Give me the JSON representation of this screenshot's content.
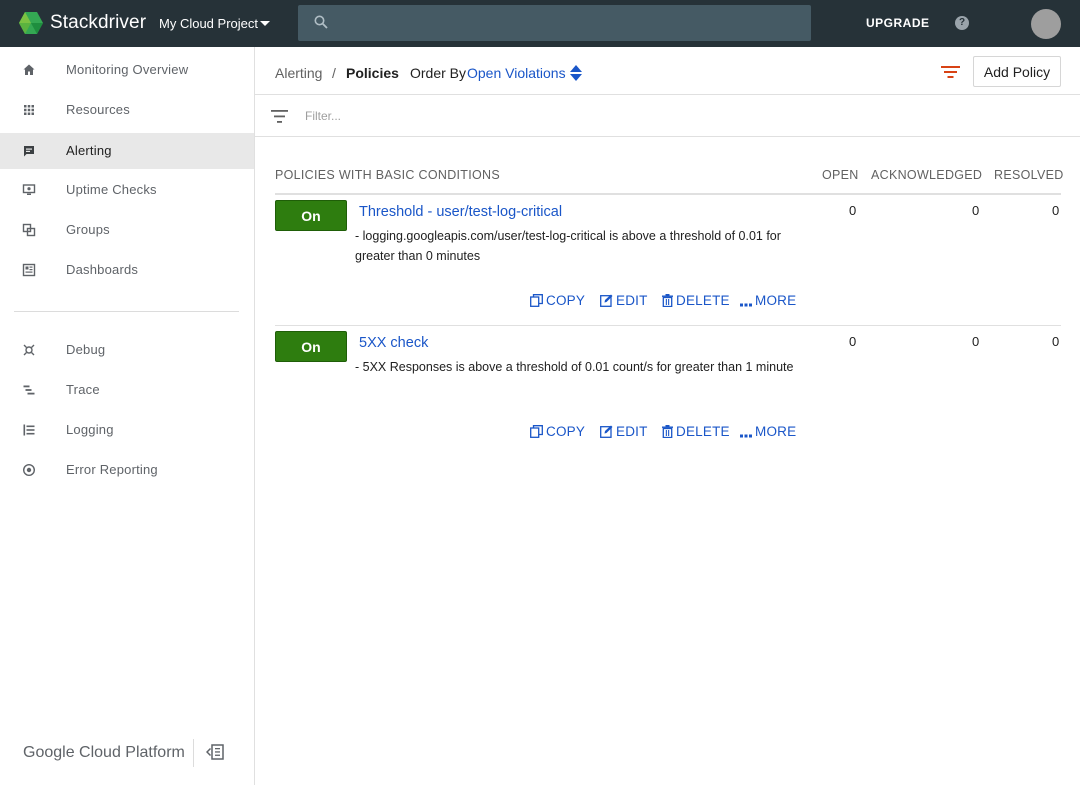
{
  "topbar": {
    "brand": "Stackdriver",
    "project": "My Cloud Project",
    "search_placeholder": "",
    "upgrade": "UPGRADE",
    "help": "?"
  },
  "sidebar": {
    "items": [
      {
        "label": "Monitoring Overview",
        "icon": "home-icon"
      },
      {
        "label": "Resources",
        "icon": "grid-icon"
      },
      {
        "label": "Alerting",
        "icon": "alert-comment-icon",
        "active": true
      },
      {
        "label": "Uptime Checks",
        "icon": "monitor-icon"
      },
      {
        "label": "Groups",
        "icon": "groups-icon"
      },
      {
        "label": "Dashboards",
        "icon": "dashboard-icon"
      }
    ],
    "items2": [
      {
        "label": "Debug",
        "icon": "debug-icon"
      },
      {
        "label": "Trace",
        "icon": "trace-icon"
      },
      {
        "label": "Logging",
        "icon": "logging-icon"
      },
      {
        "label": "Error Reporting",
        "icon": "error-reporting-icon"
      }
    ],
    "footer": "Google Cloud Platform"
  },
  "header": {
    "breadcrumb_parent": "Alerting",
    "breadcrumb_sep": "/",
    "breadcrumb_current": "Policies",
    "order_by_label": "Order By",
    "order_by_value": "Open Violations",
    "add_policy": "Add Policy"
  },
  "filter": {
    "placeholder": "Filter..."
  },
  "table": {
    "section_title": "POLICIES WITH BASIC CONDITIONS",
    "columns": {
      "open": "OPEN",
      "acknowledged": "ACKNOWLEDGED",
      "resolved": "RESOLVED"
    },
    "rows": [
      {
        "status": "On",
        "name": "Threshold - user/test-log-critical",
        "description": "- logging.googleapis.com/user/test-log-critical is above a threshold of 0.01 for greater than 0 minutes",
        "open": "0",
        "acknowledged": "0",
        "resolved": "0"
      },
      {
        "status": "On",
        "name": "5XX check",
        "description": "- 5XX Responses is above a threshold of 0.01 count/s for greater than 1 minute",
        "open": "0",
        "acknowledged": "0",
        "resolved": "0"
      }
    ],
    "actions": {
      "copy": "COPY",
      "edit": "EDIT",
      "delete": "DELETE",
      "more": "MORE"
    }
  },
  "colors": {
    "topbar": "#263238",
    "accent_link": "#1a56c8",
    "toggle_on": "#2e7d0f",
    "filter_red": "#d84315"
  }
}
